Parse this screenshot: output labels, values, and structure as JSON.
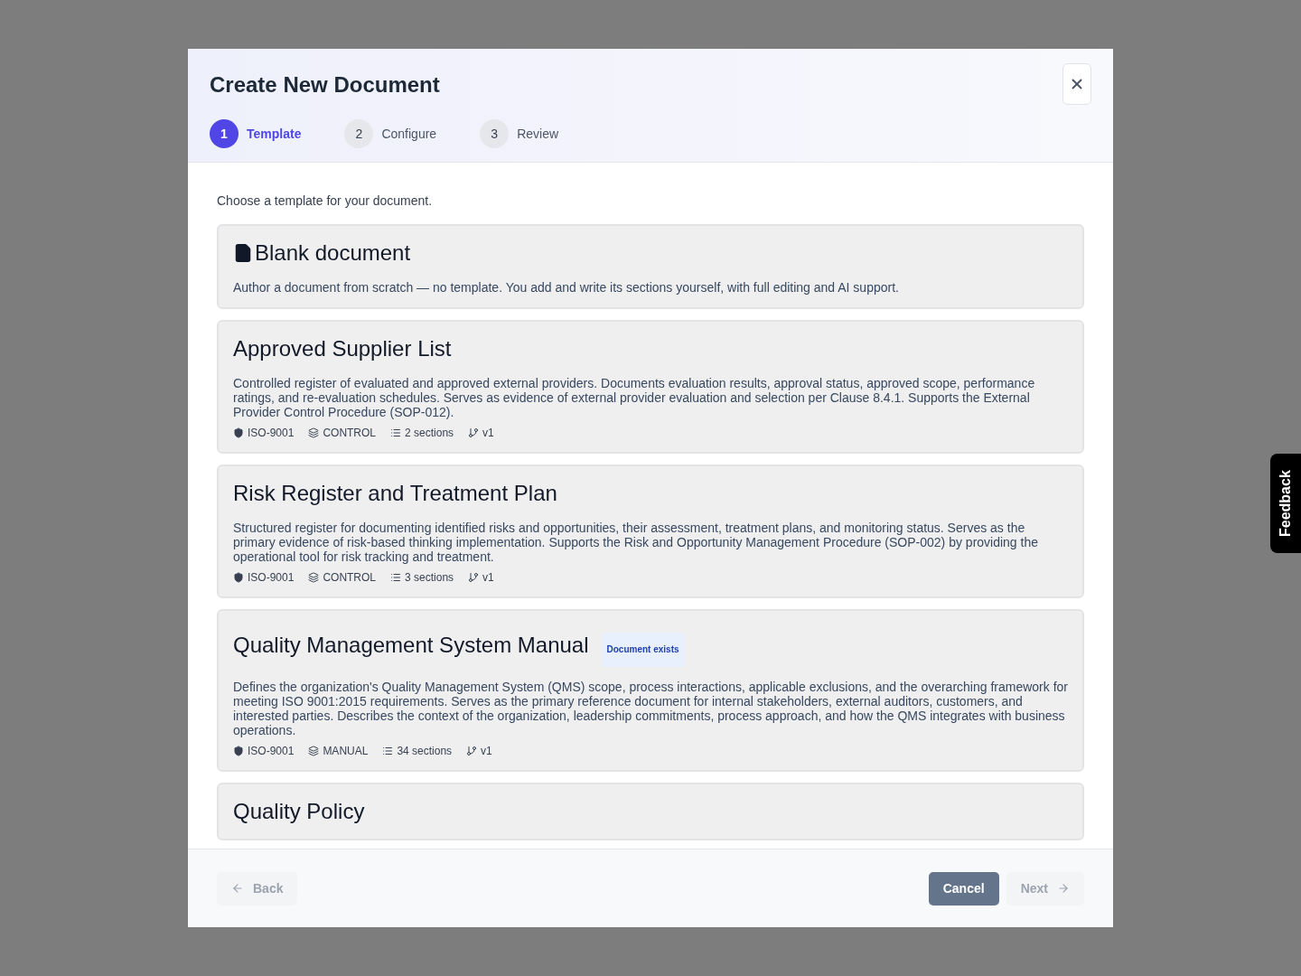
{
  "dialog": {
    "title": "Create New Document",
    "steps": [
      {
        "number": "1",
        "label": "Template",
        "selected": true
      },
      {
        "number": "2",
        "label": "Configure",
        "selected": false
      },
      {
        "number": "3",
        "label": "Review",
        "selected": false
      }
    ],
    "intro": "Choose a template for your document.",
    "templates": [
      {
        "kind": "blank",
        "title": "Blank document",
        "description": "Author a document from scratch — no template. You add and write its sections yourself, with full editing and AI support."
      },
      {
        "kind": "template",
        "title": "Approved Supplier List",
        "description": "Controlled register of evaluated and approved external providers. Documents evaluation results, approval status, approved scope, performance ratings, and re-evaluation schedules. Serves as evidence of external provider evaluation and selection per Clause 8.4.1. Supports the External Provider Control Procedure (SOP-012).",
        "standard": "ISO-9001",
        "type": "CONTROL",
        "sections": "2 sections",
        "version": "v1"
      },
      {
        "kind": "template",
        "title": "Risk Register and Treatment Plan",
        "description": "Structured register for documenting identified risks and opportunities, their assessment, treatment plans, and monitoring status. Serves as the primary evidence of risk-based thinking implementation. Supports the Risk and Opportunity Management Procedure (SOP-002) by providing the operational tool for risk tracking and treatment.",
        "standard": "ISO-9001",
        "type": "CONTROL",
        "sections": "3 sections",
        "version": "v1"
      },
      {
        "kind": "template",
        "title": "Quality Management System Manual",
        "badge": "Document exists",
        "description": "Defines the organization's Quality Management System (QMS) scope, process interactions, applicable exclusions, and the overarching framework for meeting ISO 9001:2015 requirements. Serves as the primary reference document for internal stakeholders, external auditors, customers, and interested parties. Describes the context of the organization, leadership commitments, process approach, and how the QMS integrates with business operations.",
        "standard": "ISO-9001",
        "type": "MANUAL",
        "sections": "34 sections",
        "version": "v1"
      },
      {
        "kind": "template",
        "title": "Quality Policy"
      }
    ],
    "buttons": {
      "back": {
        "label": "Back",
        "disabled": true
      },
      "cancel": {
        "label": "Cancel"
      },
      "next": {
        "label": "Next",
        "disabled": true
      }
    }
  },
  "feedback_tab": "Feedback"
}
